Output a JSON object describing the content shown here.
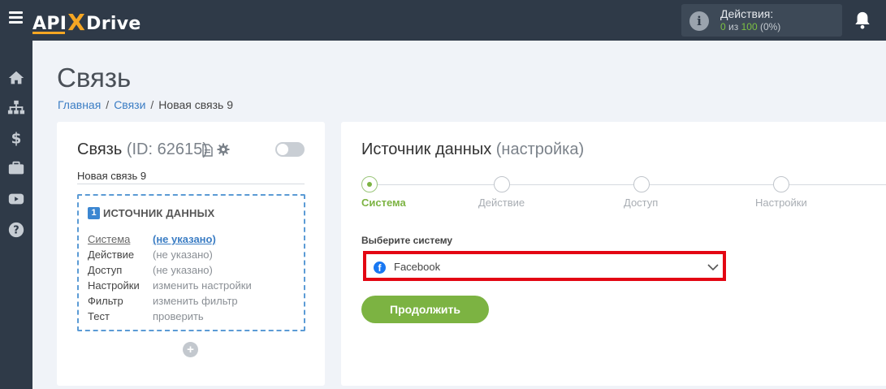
{
  "app": {
    "logo_left": "API",
    "logo_x": "X",
    "logo_right": "Drive"
  },
  "actions": {
    "title": "Действия:",
    "used": "0",
    "of_label": "из",
    "total": "100",
    "percent": "(0%)"
  },
  "page": {
    "title": "Связь"
  },
  "breadcrumb": {
    "home": "Главная",
    "links": "Связи",
    "current": "Новая связь 9"
  },
  "connection": {
    "label": "Связь",
    "id_text": "(ID: 62615)",
    "name": "Новая связь 9",
    "source_number": "1",
    "source_title": "ИСТОЧНИК ДАННЫХ",
    "rows": [
      {
        "label": "Система",
        "value": "(не указано)"
      },
      {
        "label": "Действие",
        "value": "(не указано)"
      },
      {
        "label": "Доступ",
        "value": "(не указано)"
      },
      {
        "label": "Настройки",
        "value": "изменить настройки"
      },
      {
        "label": "Фильтр",
        "value": "изменить фильтр"
      },
      {
        "label": "Тест",
        "value": "проверить"
      }
    ],
    "add_symbol": "+"
  },
  "source_setup": {
    "title": "Источник данных",
    "subtitle": "(настройка)",
    "steps": [
      {
        "label": "Система",
        "active": true
      },
      {
        "label": "Действие",
        "active": false
      },
      {
        "label": "Доступ",
        "active": false
      },
      {
        "label": "Настройки",
        "active": false
      }
    ],
    "select_label": "Выберите систему",
    "selected_system": "Facebook",
    "continue_label": "Продолжить"
  },
  "colors": {
    "topbar": "#2f3a48",
    "accent_green": "#7cb342",
    "link_blue": "#3b7dc4",
    "highlight_red": "#e30613",
    "logo_orange": "#f5a623"
  },
  "icons": [
    "menu-icon",
    "info-icon",
    "bell-icon",
    "home-icon",
    "sitemap-icon",
    "dollar-icon",
    "briefcase-icon",
    "youtube-icon",
    "help-icon",
    "document-icon",
    "gear-icon",
    "facebook-icon",
    "chevron-down-icon"
  ]
}
